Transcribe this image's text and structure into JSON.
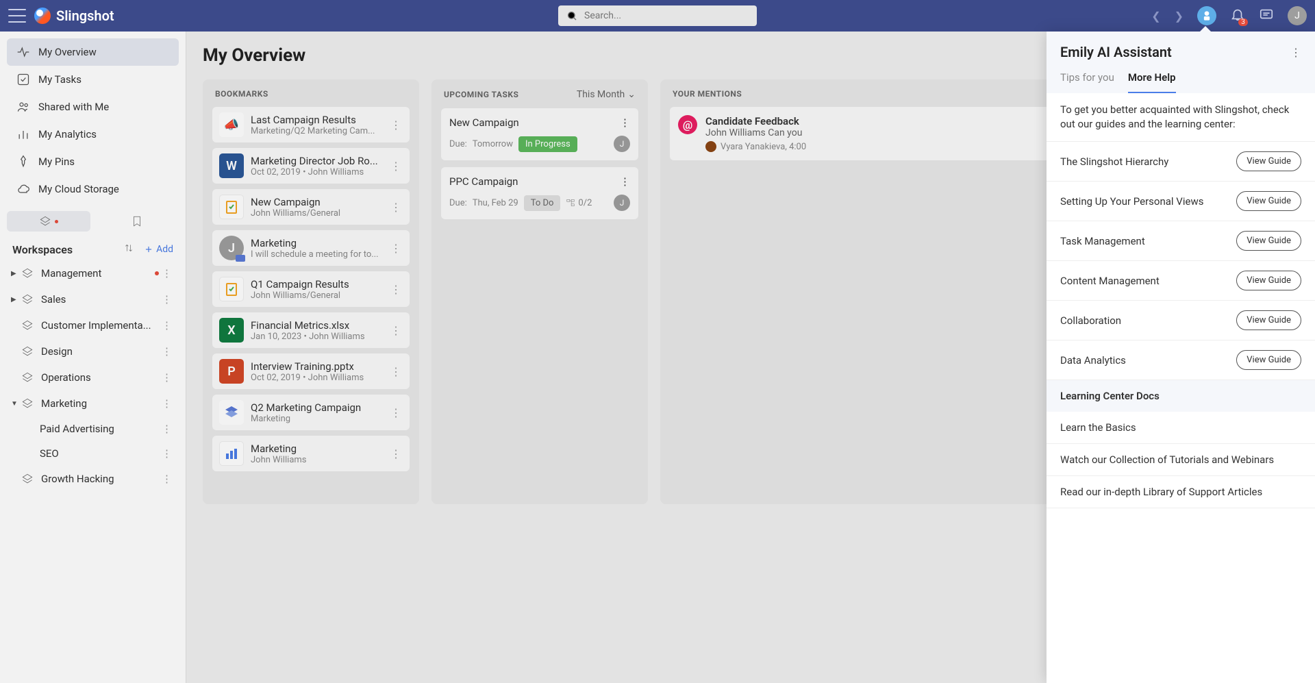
{
  "app": {
    "name": "Slingshot",
    "search_placeholder": "Search...",
    "notification_count": "3",
    "avatar_letter": "J"
  },
  "sidebar": {
    "nav": [
      {
        "label": "My Overview"
      },
      {
        "label": "My Tasks"
      },
      {
        "label": "Shared with Me"
      },
      {
        "label": "My Analytics"
      },
      {
        "label": "My Pins"
      },
      {
        "label": "My Cloud Storage"
      }
    ],
    "workspaces_title": "Workspaces",
    "add_label": "Add",
    "ws": [
      {
        "label": "Management"
      },
      {
        "label": "Sales"
      },
      {
        "label": "Customer Implementa..."
      },
      {
        "label": "Design"
      },
      {
        "label": "Operations"
      },
      {
        "label": "Marketing"
      },
      {
        "label": "Paid Advertising"
      },
      {
        "label": "SEO"
      },
      {
        "label": "Growth Hacking"
      }
    ]
  },
  "page": {
    "title": "My Overview"
  },
  "bookmarks": {
    "title": "BOOKMARKS",
    "items": [
      {
        "title": "Last Campaign Results",
        "sub": "Marketing/Q2 Marketing Cam..."
      },
      {
        "title": "Marketing Director Job Ro...",
        "sub": "Oct 02, 2019  •  John Williams"
      },
      {
        "title": "New Campaign",
        "sub": "John Williams/General"
      },
      {
        "title": "Marketing",
        "sub": "I will schedule a meeting for to..."
      },
      {
        "title": "Q1 Campaign Results",
        "sub": "John Williams/General"
      },
      {
        "title": "Financial Metrics.xlsx",
        "sub": "Jan 10, 2023  •  John Williams"
      },
      {
        "title": "Interview Training.pptx",
        "sub": "Oct 02, 2019  •  John Williams"
      },
      {
        "title": "Q2 Marketing Campaign",
        "sub": "Marketing"
      },
      {
        "title": "Marketing",
        "sub": "John Williams"
      }
    ]
  },
  "upcoming": {
    "title": "UPCOMING TASKS",
    "range": "This Month",
    "tasks": [
      {
        "title": "New Campaign",
        "due_label": "Due:",
        "due_val": "Tomorrow",
        "status": "In Progress",
        "avatar": "J"
      },
      {
        "title": "PPC Campaign",
        "due_label": "Due:",
        "due_val": "Thu, Feb 29",
        "status": "To Do",
        "subtasks": "0/2",
        "avatar": "J"
      }
    ]
  },
  "mentions": {
    "title": "YOUR MENTIONS",
    "items": [
      {
        "title": "Candidate Feedback",
        "sub": "John Williams Can you",
        "author": "Vyara Yanakieva, 4:00"
      }
    ]
  },
  "assistant": {
    "title": "Emily AI Assistant",
    "tab_tips": "Tips for you",
    "tab_more": "More Help",
    "intro": "To get you better acquainted with Slingshot, check out our guides and the learning center:",
    "view_label": "View Guide",
    "guides": [
      {
        "label": "The Slingshot Hierarchy"
      },
      {
        "label": "Setting Up Your Personal Views"
      },
      {
        "label": "Task Management"
      },
      {
        "label": "Content Management"
      },
      {
        "label": "Collaboration"
      },
      {
        "label": "Data Analytics"
      }
    ],
    "docs_title": "Learning Center Docs",
    "docs": [
      {
        "label": "Learn the Basics"
      },
      {
        "label": "Watch our Collection of Tutorials and Webinars"
      },
      {
        "label": "Read our in-depth Library of Support Articles"
      }
    ]
  }
}
